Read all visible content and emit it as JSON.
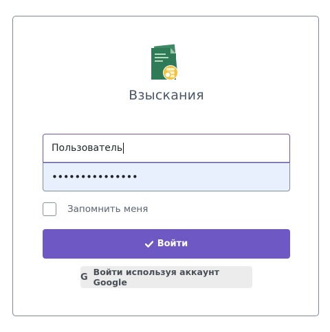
{
  "app": {
    "title": "Взыскания"
  },
  "login_form": {
    "username_value": "Пользователь",
    "password_value": "•••••••••••••••",
    "remember_label": "Запомнить меня",
    "remember_checked": false,
    "login_button_label": "Войти",
    "google_button_label": "Войти используя аккаунт Google",
    "google_icon_glyph": "G"
  },
  "icons": {
    "logo": "document-coins-logo-icon",
    "login": "check-icon",
    "google": "google-g-icon"
  },
  "colors": {
    "primary": "#6e59c4",
    "logo_green": "#2f7a57",
    "logo_yellow": "#f3c13a",
    "autofill_bg": "#e8f0fe"
  }
}
